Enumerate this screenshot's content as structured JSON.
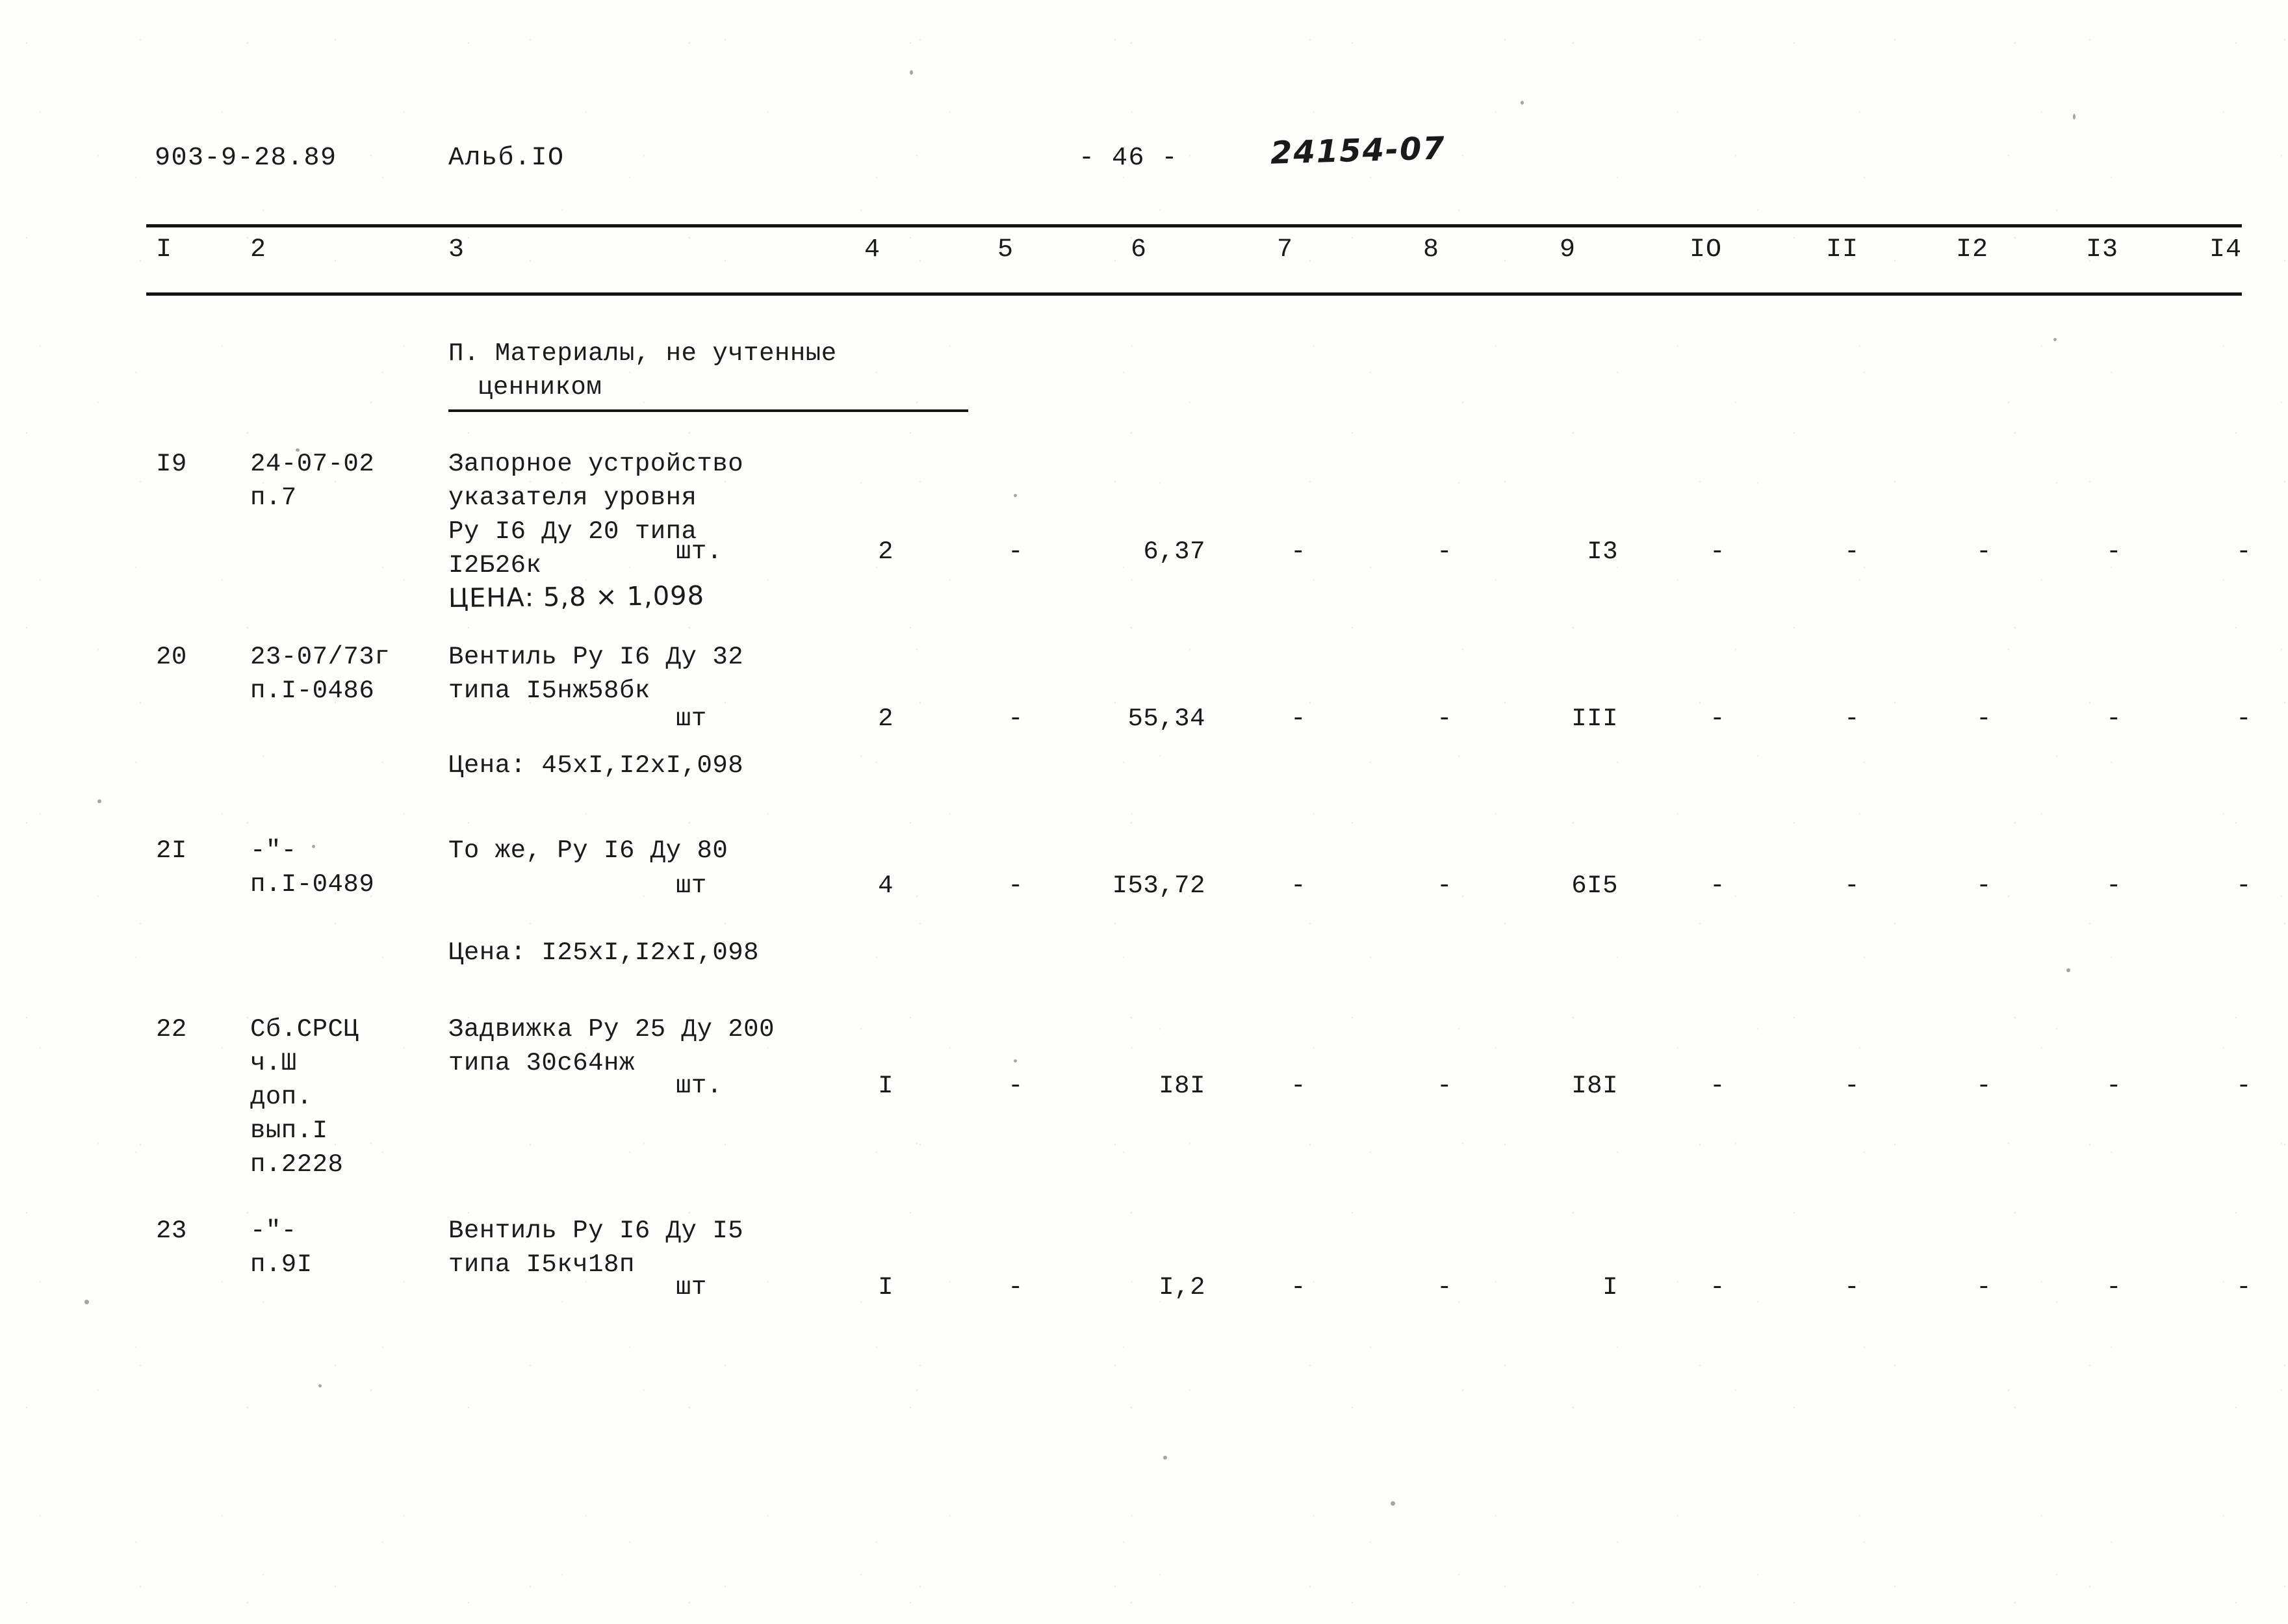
{
  "header": {
    "doc_code": "903-9-28.89",
    "album": "Альб.IO",
    "page_number": "- 46 -",
    "handwritten_code": "24154-07"
  },
  "table": {
    "column_numbers": [
      "I",
      "2",
      "3",
      "4",
      "5",
      "6",
      "7",
      "8",
      "9",
      "IO",
      "II",
      "I2",
      "I3",
      "I4"
    ],
    "section_title_line1": "П. Материалы, не учтенные",
    "section_title_line2": "ценником",
    "rows": [
      {
        "pos": "I9",
        "code_lines": [
          "24-07-02",
          "п.7"
        ],
        "name_lines": [
          "Запорное устройство",
          "указателя уровня",
          "Ру I6 Ду 20 типа",
          "I2Б26к"
        ],
        "unit": "шт.",
        "qty": "2",
        "c5": "-",
        "c6": "6,37",
        "c7": "-",
        "c8": "-",
        "c9": "I3",
        "c10": "-",
        "c11": "-",
        "c12": "-",
        "c13": "-",
        "c14": "-",
        "price_note": "ЦЕНА: 5,8 × 1,098",
        "price_note_hand": true
      },
      {
        "pos": "20",
        "code_lines": [
          "23-07/73г",
          "п.I-0486"
        ],
        "name_lines": [
          "Вентиль Ру I6 Ду 32",
          "типа I5нж58бк"
        ],
        "unit": "шт",
        "qty": "2",
        "c5": "-",
        "c6": "55,34",
        "c7": "-",
        "c8": "-",
        "c9": "III",
        "c10": "-",
        "c11": "-",
        "c12": "-",
        "c13": "-",
        "c14": "-",
        "price_note": "Цена: 45xI,I2xI,098",
        "price_note_hand": false
      },
      {
        "pos": "2I",
        "code_lines": [
          "-\"-",
          "п.I-0489"
        ],
        "name_lines": [
          "То же, Ру I6 Ду 80"
        ],
        "unit": "шт",
        "qty": "4",
        "c5": "-",
        "c6": "I53,72",
        "c7": "-",
        "c8": "-",
        "c9": "6I5",
        "c10": "-",
        "c11": "-",
        "c12": "-",
        "c13": "-",
        "c14": "-",
        "price_note": "Цена: I25xI,I2xI,098",
        "price_note_hand": false
      },
      {
        "pos": "22",
        "code_lines": [
          "Сб.СРСЦ",
          "ч.Ш",
          "доп.",
          "вып.I",
          "п.2228"
        ],
        "name_lines": [
          "Задвижка Ру 25 Ду 200",
          "типа 30с64нж"
        ],
        "unit": "шт.",
        "qty": "I",
        "c5": "-",
        "c6": "I8I",
        "c7": "-",
        "c8": "-",
        "c9": "I8I",
        "c10": "-",
        "c11": "-",
        "c12": "-",
        "c13": "-",
        "c14": "-",
        "price_note": "",
        "price_note_hand": false
      },
      {
        "pos": "23",
        "code_lines": [
          "-\"-",
          "п.9I"
        ],
        "name_lines": [
          "Вентиль Ру I6 Ду I5",
          "типа I5кч18п"
        ],
        "unit": "шт",
        "qty": "I",
        "c5": "-",
        "c6": "I,2",
        "c7": "-",
        "c8": "-",
        "c9": "I",
        "c10": "-",
        "c11": "-",
        "c12": "-",
        "c13": "-",
        "c14": "-",
        "price_note": "",
        "price_note_hand": false
      }
    ]
  }
}
